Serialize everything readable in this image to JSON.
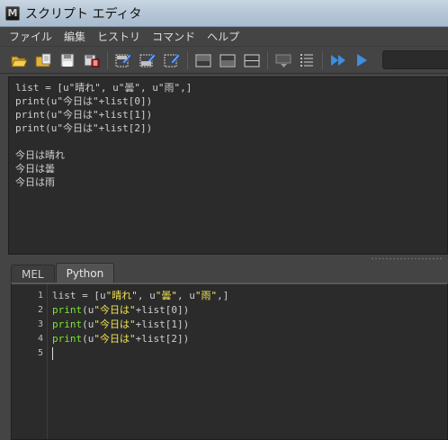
{
  "window": {
    "title": "スクリプト エディタ",
    "icon": "maya-app-icon"
  },
  "menu": {
    "items": [
      "ファイル",
      "編集",
      "ヒストリ",
      "コマンド",
      "ヘルプ"
    ]
  },
  "toolbar": {
    "buttons": [
      "open-script-icon",
      "source-script-icon",
      "save-script-icon",
      "save-script-to-shelf-icon",
      "clear-history-icon",
      "clear-input-icon",
      "clear-all-icon",
      "show-history-only-icon",
      "show-input-only-icon",
      "show-both-icon",
      "echo-all-commands-icon",
      "line-numbers-icon",
      "execute-all-icon",
      "execute-icon"
    ],
    "accent": "#3d8fe0"
  },
  "output": {
    "lines": [
      "list = [u\"晴れ\", u\"曇\", u\"雨\",]",
      "print(u\"今日は\"+list[0])",
      "print(u\"今日は\"+list[1])",
      "print(u\"今日は\"+list[2])",
      "",
      "今日は晴れ",
      "今日は曇",
      "今日は雨"
    ]
  },
  "tabs": [
    {
      "label": "MEL",
      "active": false
    },
    {
      "label": "Python",
      "active": true
    }
  ],
  "editor": {
    "line_numbers": [
      "1",
      "2",
      "3",
      "4",
      "5"
    ],
    "line1": {
      "a": "list = [u",
      "s1": "\"晴れ\"",
      "b": ", u",
      "s2": "\"曇\"",
      "c": ", u",
      "s3": "\"雨\"",
      "d": ",]"
    },
    "line2": {
      "kw": "print",
      "a": "(u",
      "s": "\"今日は\"",
      "b": "+list[0])"
    },
    "line3": {
      "kw": "print",
      "a": "(u",
      "s": "\"今日は\"",
      "b": "+list[1])"
    },
    "line4": {
      "kw": "print",
      "a": "(u",
      "s": "\"今日は\"",
      "b": "+list[2])"
    },
    "colors": {
      "keyword": "#79e62e",
      "string": "#f2e24f",
      "text": "#cfcfcf"
    }
  }
}
